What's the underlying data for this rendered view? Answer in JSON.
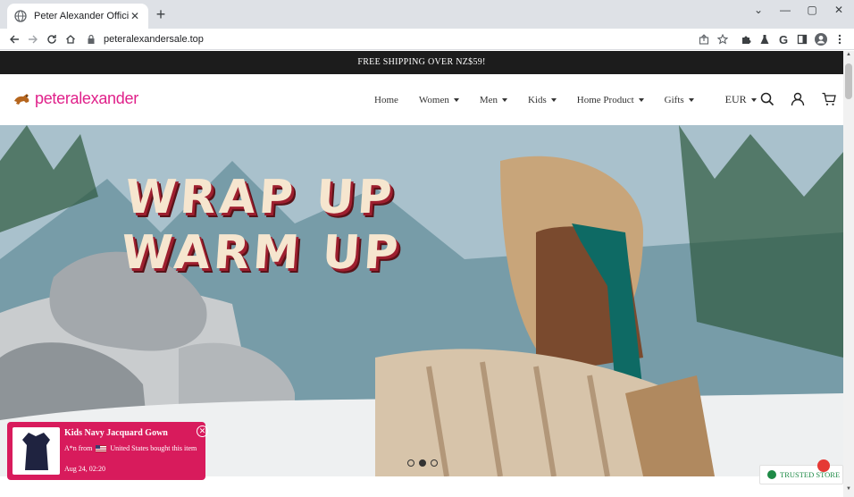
{
  "browser": {
    "tab_title": "Peter Alexander Official Site | Py",
    "url": "peteralexandersale.top"
  },
  "announcement": "FREE SHIPPING OVER NZ$59!",
  "header": {
    "brand": "peteralexander",
    "nav": [
      {
        "label": "Home"
      },
      {
        "label": "Women"
      },
      {
        "label": "Men"
      },
      {
        "label": "Kids"
      },
      {
        "label": "Home Product"
      },
      {
        "label": "Gifts"
      }
    ],
    "currency": "EUR"
  },
  "hero": {
    "headline_line1": "WRAP UP",
    "headline_line2": "WARM UP",
    "slides": 3,
    "active_slide": 2
  },
  "popup": {
    "title": "Kids Navy Jacquard Gown",
    "name": "A*n from",
    "location": "United States bought this item",
    "time": "Aug 24, 02:20"
  },
  "trusted": {
    "label": "TRUSTED STORE"
  },
  "colors": {
    "brand_pink": "#e0218a",
    "popup_bg": "#d81b5c",
    "announcement_bg": "#1c1c1c",
    "trusted_green": "#1e8a46"
  }
}
